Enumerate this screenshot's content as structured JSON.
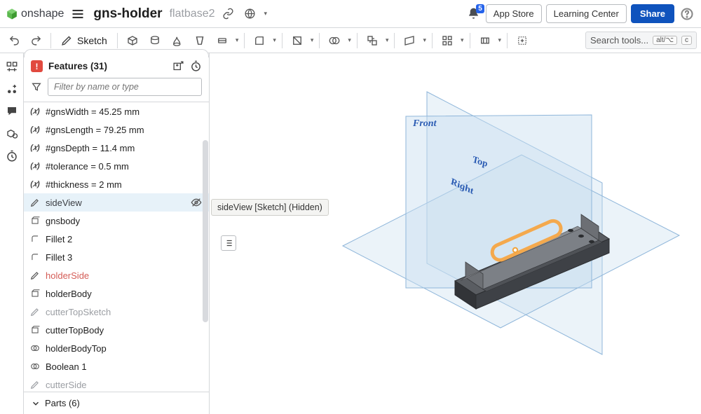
{
  "app": {
    "name": "onshape"
  },
  "doc": {
    "title": "gns-holder",
    "branch": "flatbase2"
  },
  "topbar": {
    "notif_count": "5",
    "app_store": "App Store",
    "learning_center": "Learning Center",
    "share": "Share"
  },
  "toolbar": {
    "sketch": "Sketch",
    "search_placeholder": "Search tools...",
    "kbd1": "alt/⌥",
    "kbd2": "c"
  },
  "panel": {
    "features_title": "Features (31)",
    "filter_placeholder": "Filter by name or type",
    "parts": "Parts (6)"
  },
  "tooltip": "sideView [Sketch] (Hidden)",
  "features": [
    {
      "kind": "var",
      "label": "#gnsWidth = 45.25 mm"
    },
    {
      "kind": "var",
      "label": "#gnsLength = 79.25 mm"
    },
    {
      "kind": "var",
      "label": "#gnsDepth = 11.4 mm"
    },
    {
      "kind": "var",
      "label": "#tolerance = 0.5 mm"
    },
    {
      "kind": "var",
      "label": "#thickness = 2 mm"
    },
    {
      "kind": "sketch",
      "label": "sideView",
      "selected": true,
      "hidden": true
    },
    {
      "kind": "ext",
      "label": "gnsbody"
    },
    {
      "kind": "fillet",
      "label": "Fillet 2"
    },
    {
      "kind": "fillet",
      "label": "Fillet 3"
    },
    {
      "kind": "sketch",
      "label": "holderSide",
      "err": true
    },
    {
      "kind": "ext",
      "label": "holderBody"
    },
    {
      "kind": "sketch",
      "label": "cutterTopSketch",
      "dim": true
    },
    {
      "kind": "ext",
      "label": "cutterTopBody"
    },
    {
      "kind": "bool",
      "label": "holderBodyTop"
    },
    {
      "kind": "bool",
      "label": "Boolean 1"
    },
    {
      "kind": "sketch",
      "label": "cutterSide",
      "dim": true
    }
  ],
  "planes": {
    "front": "Front",
    "top": "Top",
    "right": "Right"
  }
}
